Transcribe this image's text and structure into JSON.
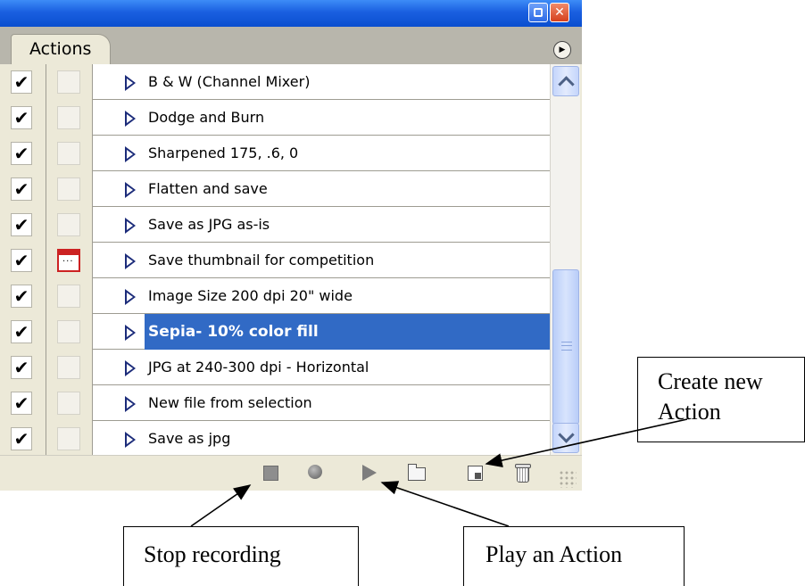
{
  "window": {
    "minimize_icon": "minimize-icon",
    "close_icon": "close-icon",
    "close_glyph": "✕"
  },
  "panel": {
    "tab_label": "Actions",
    "menu_glyph": "▶"
  },
  "actions": [
    {
      "label": "B & W (Channel Mixer)",
      "checked": true,
      "dialog": false,
      "selected": false
    },
    {
      "label": "Dodge and Burn",
      "checked": true,
      "dialog": false,
      "selected": false
    },
    {
      "label": "Sharpened 175, .6, 0",
      "checked": true,
      "dialog": false,
      "selected": false
    },
    {
      "label": "Flatten and save",
      "checked": true,
      "dialog": false,
      "selected": false
    },
    {
      "label": "Save as JPG as-is",
      "checked": true,
      "dialog": false,
      "selected": false
    },
    {
      "label": "Save thumbnail for competition",
      "checked": true,
      "dialog": true,
      "selected": false
    },
    {
      "label": "Image Size 200 dpi 20\" wide",
      "checked": true,
      "dialog": false,
      "selected": false
    },
    {
      "label": "Sepia- 10% color fill",
      "checked": true,
      "dialog": false,
      "selected": true
    },
    {
      "label": "JPG at 240-300 dpi - Horizontal",
      "checked": true,
      "dialog": false,
      "selected": false
    },
    {
      "label": "New file from selection",
      "checked": true,
      "dialog": false,
      "selected": false
    },
    {
      "label": "Save as jpg",
      "checked": true,
      "dialog": false,
      "selected": false
    }
  ],
  "check_glyph": "✔",
  "toolbar": {
    "icons": [
      "stop-icon",
      "record-icon",
      "play-icon",
      "folder-icon",
      "new-action-icon",
      "trash-icon"
    ]
  },
  "callouts": {
    "create_line1": "Create new",
    "create_line2": "Action",
    "stop": "Stop recording",
    "play": "Play an Action"
  },
  "colors": {
    "titlebar": "#0a4ecf",
    "selection": "#316ac5",
    "panel_bg": "#ece9d8"
  }
}
